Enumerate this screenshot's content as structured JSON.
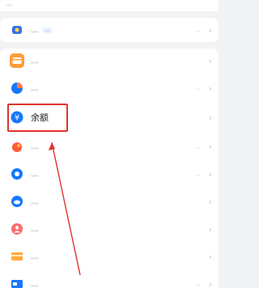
{
  "top_note": "...",
  "rows": [
    {
      "id": "r0",
      "label": "...",
      "badge": "...",
      "right": "..."
    },
    {
      "id": "r1",
      "label": "...",
      "right": ""
    },
    {
      "id": "r2",
      "label": "...",
      "right": "..."
    },
    {
      "id": "r3",
      "label": "余额",
      "right": ""
    },
    {
      "id": "r4",
      "label": "...",
      "right": "..."
    },
    {
      "id": "r5",
      "label": "...",
      "right": "..."
    },
    {
      "id": "r6",
      "label": "...",
      "right": ""
    },
    {
      "id": "r7",
      "label": "...",
      "right": ""
    },
    {
      "id": "r8",
      "label": "...",
      "right": ""
    },
    {
      "id": "r9",
      "label": "...",
      "right": "..."
    }
  ],
  "colors": {
    "accent_blue": "#1677ff",
    "highlight_red": "#e0342b",
    "orange": "#ff8a00"
  },
  "icons": {
    "r0": "membership-icon",
    "r1": "card-icon",
    "r2": "pie-chart-icon",
    "r3": "yuan-coin-icon",
    "r4": "piggy-bank-icon",
    "r5": "flower-icon",
    "r6": "cloud-icon",
    "r7": "person-icon",
    "r8": "bank-card-icon",
    "r9": "shield-card-icon"
  }
}
